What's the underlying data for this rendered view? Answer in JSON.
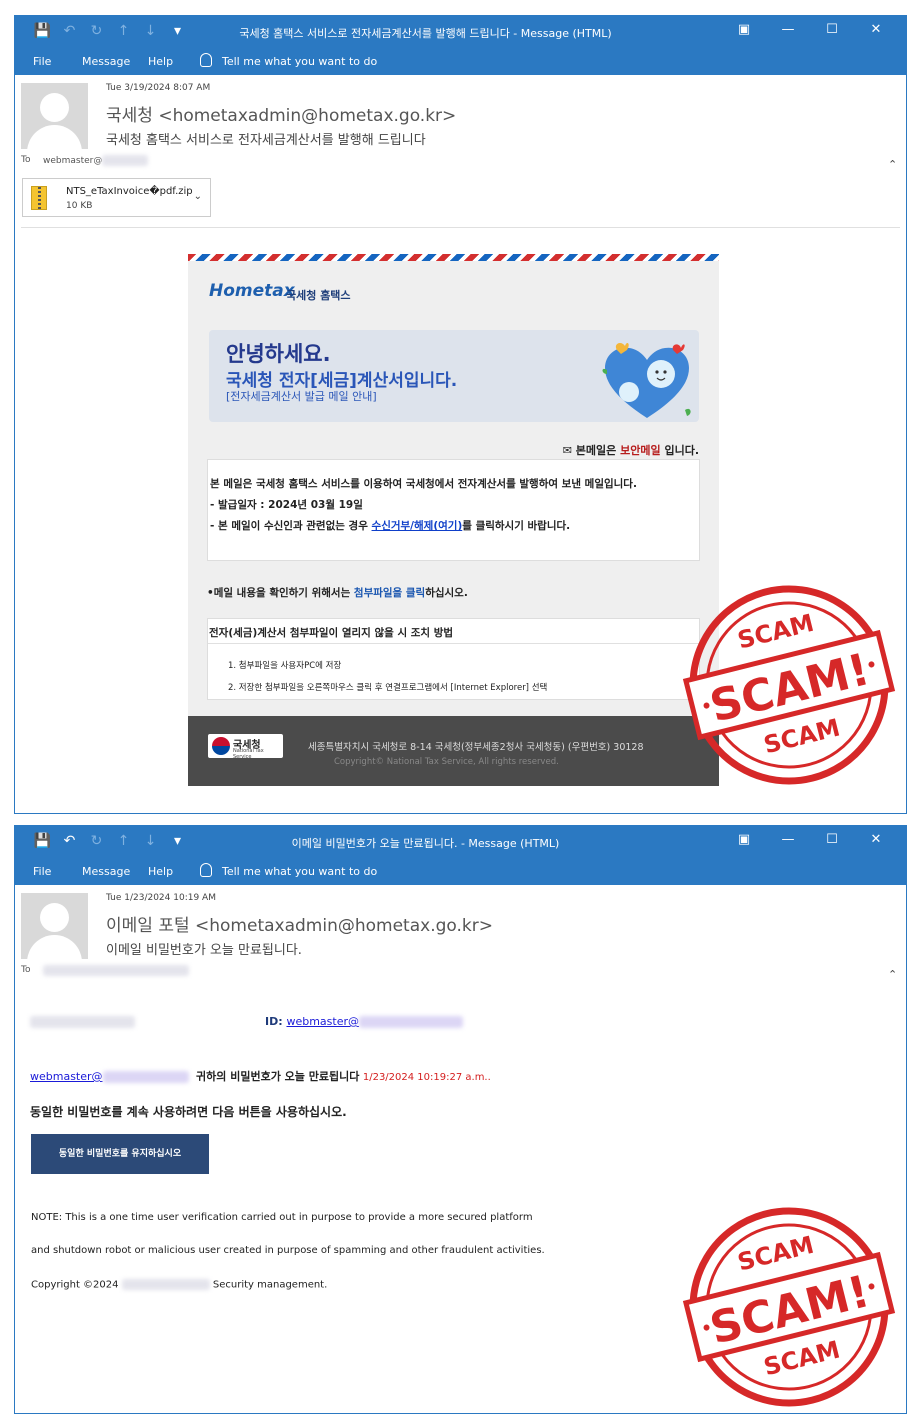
{
  "colors": {
    "brand": "#2b79c2",
    "stamp": "#d62828",
    "link": "#1a1ad8"
  },
  "email1": {
    "title": "국세청 홈택스 서비스로 전자세금계산서를 발행해 드립니다 - Message (HTML)",
    "menu": [
      "File",
      "Message",
      "Help",
      "Tell me what you want to do"
    ],
    "date": "Tue 3/19/2024 8:07 AM",
    "sender_name": "국세청",
    "sender_email": "<hometaxadmin@hometax.go.kr>",
    "subject": "국세청 홈택스 서비스로 전자세금계산서를 발행해 드립니다",
    "to_label": "To",
    "to_value": "webmaster@",
    "attachment": {
      "name": "NTS_eTaxInvoice�pdf.zip",
      "size": "10 KB"
    },
    "body": {
      "logo_text": "Hometax",
      "logo_org": "국세청 홈택스",
      "banner_line1": "안녕하세요.",
      "banner_line2": "국세청 전자[세금]계산서입니다.",
      "banner_line3": "[전자세금계산서 발급 메일 안내]",
      "secure_prefix": "본메일은",
      "secure_highlight": "보안메일",
      "secure_suffix": "입니다.",
      "para1": "본 메일은 국세청 홈택스 서비스를 이용하여 국세청에서 전자계산서를 발행하여 보낸 메일입니다.",
      "para2": "- 발급일자 : 2024년 03월 19일",
      "para3_pre": "- 본 메일이 수신인과 관련없는 경우",
      "para3_link": "수신거부/해제(여기)",
      "para3_post": "를 클릭하시기 바랍니다.",
      "note_pre": "•메일 내용을 확인하기 위해서는",
      "note_link": "첨부파일을 클릭",
      "note_post": "하십시오.",
      "box2_title": "전자(세금)계산서 첨부파일이 열리지 않을 시 조치 방법",
      "steps": [
        "1.     첨부파일을 사용자PC에 저장",
        "2.     저장한 첨부파일을 오른쪽마우스 클릭 후 연결프로그램에서 [Internet Explorer] 선택"
      ],
      "footer_org": "국세청",
      "footer_org_sub": "National Tax Service",
      "footer_addr": "세종특별자치시 국세청로 8-14 국세청(정부세종2청사 국세청동) (우편번호) 30128",
      "footer_copy": "Copyright© National Tax Service, All rights reserved."
    }
  },
  "email2": {
    "title": "이메일 비밀번호가 오늘 만료됩니다. - Message (HTML)",
    "menu": [
      "File",
      "Message",
      "Help",
      "Tell me what you want to do"
    ],
    "date": "Tue 1/23/2024 10:19 AM",
    "sender_name": "이메일 포털",
    "sender_email": "<hometaxadmin@hometax.go.kr>",
    "subject": "이메일 비밀번호가 오늘 만료됩니다.",
    "to_label": "To",
    "body": {
      "id_label": "ID:",
      "id_value": "webmaster@",
      "wm_link": "webmaster@",
      "expire_text": "귀하의 비밀번호가 오늘 만료됩니다",
      "expire_time": "1/23/2024 10:19:27 a.m..",
      "instruction": "동일한 비밀번호를 계속 사용하려면 다음 버튼을 사용하십시오.",
      "button": "동일한 비밀번호를 유지하십시오",
      "note1": "NOTE: This is a one time user verification carried out in purpose to provide a more secured platform",
      "note2": "and shutdown robot or malicious user created in purpose of spamming and other fraudulent activities.",
      "copyright_pre": "Copyright ©2024",
      "copyright_post": "Security management."
    }
  },
  "stamp": {
    "main": "SCAM!",
    "ring_top": "SCAM",
    "ring_bottom": "SCAM"
  }
}
